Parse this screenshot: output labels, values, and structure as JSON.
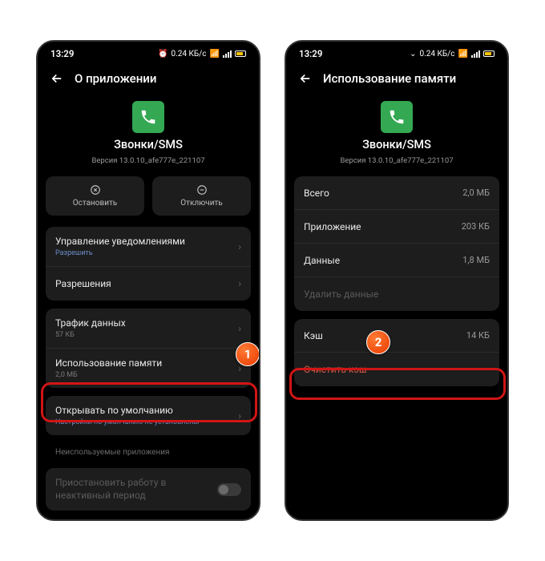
{
  "status": {
    "time": "13:29",
    "kbs": "0.24"
  },
  "screen1": {
    "title": "О приложении",
    "app_name": "Звонки/SMS",
    "app_version": "Версия 13.0.10_afe777e_221107",
    "btn_stop": "Остановить",
    "btn_disable": "Отключить",
    "row_notifications": "Управление уведомлениями",
    "row_notifications_sub": "Разрешить",
    "row_permissions": "Разрешения",
    "row_traffic": "Трафик данных",
    "row_traffic_sub": "57 КБ",
    "row_memory": "Использование памяти",
    "row_memory_sub": "2,0 МБ",
    "row_default": "Открывать по умолчанию",
    "row_default_sub": "Настройки по умолчанию не установлены",
    "section_unused": "Неиспользуемые приложения",
    "row_inactive": "Приостановить работу в неактивный период"
  },
  "screen2": {
    "title": "Использование памяти",
    "app_name": "Звонки/SMS",
    "app_version": "Версия 13.0.10_afe777e_221107",
    "row_total": "Всего",
    "row_total_val": "2,0 МБ",
    "row_app": "Приложение",
    "row_app_val": "203 КБ",
    "row_data": "Данные",
    "row_data_val": "1,8 МБ",
    "row_delete": "Удалить данные",
    "row_cache": "Кэш",
    "row_cache_val": "14 КБ",
    "row_clear": "Очистить кэш"
  },
  "badges": {
    "b1": "1",
    "b2": "2"
  }
}
